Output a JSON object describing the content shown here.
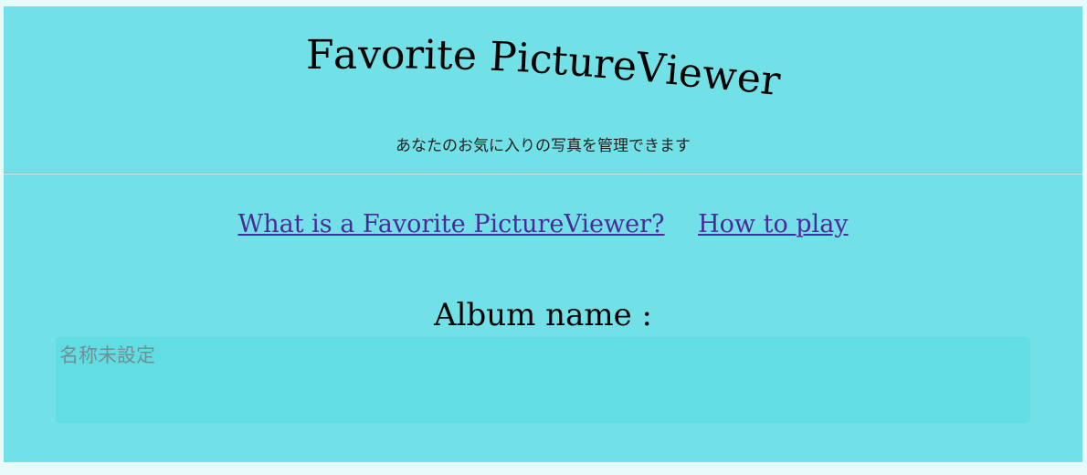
{
  "header": {
    "title": "Favorite PictureViewer",
    "subtitle": "あなたのお気に入りの写真を管理できます"
  },
  "nav": {
    "what_is_label": "What is a Favorite PictureViewer?",
    "how_to_label": "How to play"
  },
  "album": {
    "label": "Album name :",
    "placeholder": "名称未設定",
    "value": ""
  },
  "colors": {
    "background": "#72e0e7",
    "input_background": "#62dde3",
    "link": "#4b2a9a"
  }
}
